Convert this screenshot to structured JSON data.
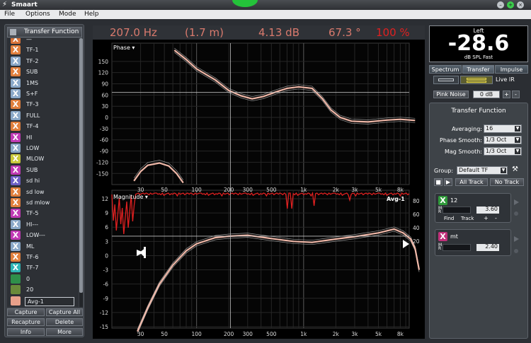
{
  "window": {
    "title": "Smaart"
  },
  "menu": [
    "File",
    "Options",
    "Mode",
    "Help"
  ],
  "left_panel": {
    "header": "Transfer Function",
    "traces": [
      {
        "label": "—",
        "color": "#d9743a"
      },
      {
        "label": "TF-1",
        "color": "#e07f3d"
      },
      {
        "label": "TF-2",
        "color": "#8aa8c8"
      },
      {
        "label": "SUB",
        "color": "#e07f3d"
      },
      {
        "label": "1MS",
        "color": "#8aa8c8"
      },
      {
        "label": "S+F",
        "color": "#8aa8c8"
      },
      {
        "label": "TF-3",
        "color": "#e07f3d"
      },
      {
        "label": "FULL",
        "color": "#8aa8c8"
      },
      {
        "label": "TF-4",
        "color": "#e07f3d"
      },
      {
        "label": "HI",
        "color": "#c03ab4"
      },
      {
        "label": "LOW",
        "color": "#8aa8c8"
      },
      {
        "label": "MLOW",
        "color": "#c9c83a"
      },
      {
        "label": "SUB",
        "color": "#c03ab4"
      },
      {
        "label": "sd hi",
        "color": "#6b5fc6"
      },
      {
        "label": "sd low",
        "color": "#e07f3d"
      },
      {
        "label": "sd mlow",
        "color": "#e07f3d"
      },
      {
        "label": "TF-5",
        "color": "#c03ab4"
      },
      {
        "label": "HI---",
        "color": "#8aa8c8"
      },
      {
        "label": "LOW---",
        "color": "#c03ab4"
      },
      {
        "label": "ML",
        "color": "#8aa8c8"
      },
      {
        "label": "TF-6",
        "color": "#e07f3d"
      },
      {
        "label": "TF-7",
        "color": "#2fb5b5"
      },
      {
        "label": "0",
        "color": "#2f8f4a"
      },
      {
        "label": "20",
        "color": "#6a8a3a"
      },
      {
        "label": "Avg-1",
        "color": "#e8a08a"
      }
    ],
    "buttons": {
      "capture": "Capture",
      "capture_all": "Capture All",
      "recapture": "Recapture",
      "delete": "Delete",
      "info": "Info",
      "more": "More"
    }
  },
  "readout": {
    "frequency": "207.0 Hz",
    "distance": "(1.7 m)",
    "level": "4.13 dB",
    "phase": "67.3 °",
    "coherence": "100 %"
  },
  "plots": {
    "phase": {
      "label": "Phase ▾",
      "y_ticks": [
        "150",
        "120",
        "90",
        "60",
        "30",
        "0",
        "-30",
        "-60",
        "-90",
        "-120",
        "-150"
      ]
    },
    "magnitude": {
      "label": "Magnitude ▾",
      "y_ticks": [
        "12",
        "9",
        "6",
        "3",
        "0",
        "-3",
        "-6",
        "-9",
        "-12",
        "-15"
      ],
      "coherence_ticks": [
        "80",
        "60",
        "40",
        "20"
      ],
      "trace_label": "Avg-1"
    },
    "x_ticks": [
      "30",
      "50",
      "100",
      "200",
      "300",
      "500",
      "1k",
      "2k",
      "3k",
      "5k",
      "8k"
    ]
  },
  "spl_meter": {
    "channel": "Left",
    "value": "-28.6",
    "unit": "dB SPL Fast"
  },
  "view_tabs": [
    "Spectrum",
    "Transfer",
    "Impulse"
  ],
  "live_ir": "Live IR",
  "pink_noise": {
    "label": "Pink Noise",
    "level": "0 dB",
    "plus": "+",
    "minus": "-"
  },
  "tf_panel": {
    "title": "Transfer Function",
    "averaging_label": "Averaging:",
    "averaging_value": "16",
    "phase_smooth_label": "Phase Smooth:",
    "phase_smooth_value": "1/3 Oct",
    "mag_smooth_label": "Mag Smooth:",
    "mag_smooth_value": "1/3 Oct",
    "group_label": "Group:",
    "group_value": "Default TF",
    "all_track": "All Track",
    "no_track": "No Track"
  },
  "tracks": [
    {
      "name": "12",
      "delay": "3.60",
      "color": "#2f9a3a",
      "find": "Find",
      "track": "Track",
      "plus": "+",
      "minus": "-"
    },
    {
      "name": "mt",
      "delay": "2.40",
      "color": "#c0307a"
    }
  ],
  "colors": {
    "accent_red": "#e02020",
    "trace_salmon": "#f0b8a8",
    "readout": "#d97a6d"
  }
}
